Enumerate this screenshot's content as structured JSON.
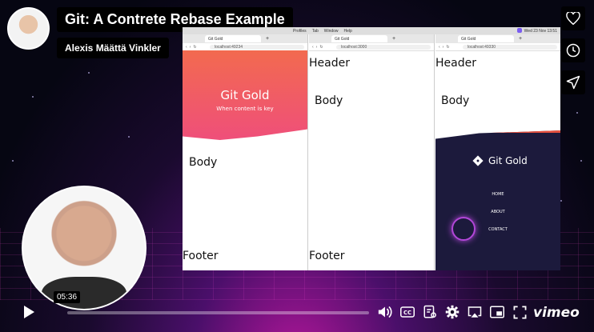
{
  "video": {
    "title": "Git: A Contrete Rebase Example",
    "author": "Alexis Määttä Vinkler",
    "timestamp": "05:36",
    "progress": 0,
    "brand": "vimeo"
  },
  "side_actions": [
    "heart-icon",
    "clock-icon",
    "send-icon"
  ],
  "screen": {
    "menubar": {
      "items": [
        "Profiles",
        "Tab",
        "Window",
        "Help"
      ],
      "clock": "Wed 23 Nov 13:51"
    },
    "windows": [
      {
        "tab": "Git Gold",
        "url": "localhost:49234",
        "hero_title": "Git Gold",
        "hero_subtitle": "When content is key",
        "body": "Body",
        "footer": "Footer"
      },
      {
        "tab": "Git Gold",
        "url": "localhost:3000",
        "header": "Header",
        "body": "Body",
        "footer": "Footer"
      },
      {
        "tab": "Git Gold",
        "url": "localhost:49330",
        "header": "Header",
        "body": "Body",
        "brand": "Git Gold",
        "nav": [
          "HOME",
          "ABOUT",
          "CONTACT"
        ]
      }
    ]
  },
  "controls": {
    "icons": [
      "volume-icon",
      "cc-icon",
      "transcript-icon",
      "settings-icon",
      "airplay-icon",
      "pip-icon",
      "fullscreen-icon"
    ]
  },
  "colors": {
    "accent": "#ef4f7a",
    "footer_bg": "#1c1a3c",
    "background": "#1a0a2e"
  }
}
